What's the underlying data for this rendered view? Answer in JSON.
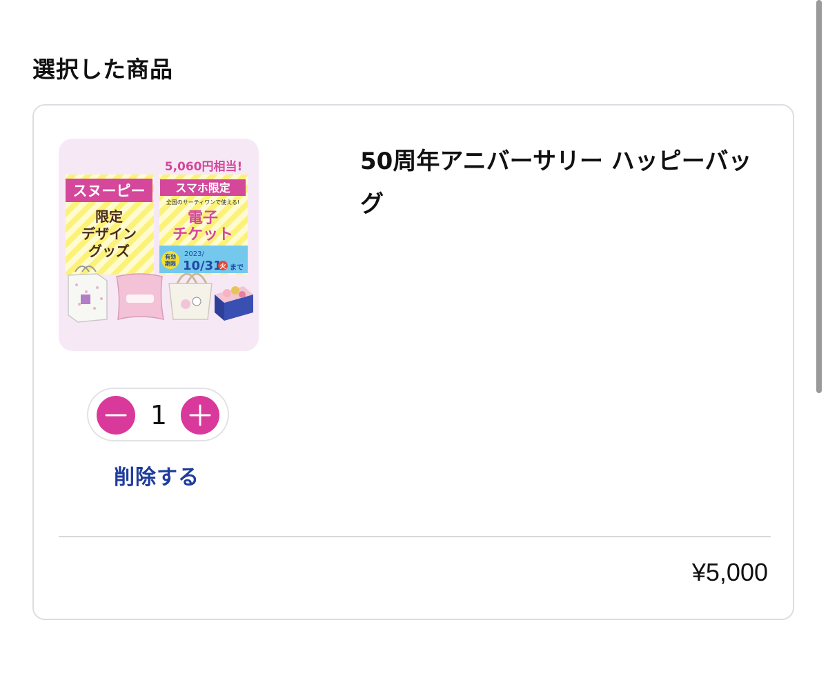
{
  "section": {
    "title": "選択した商品"
  },
  "item": {
    "name": "50周年アニバーサリー ハッピーバッグ",
    "quantity": "1",
    "delete_label": "削除する",
    "price": "¥5,000",
    "image": {
      "ribbon_text": "5,060円相当!",
      "left_title": "スヌーピー",
      "left_body": [
        "限定",
        "デザイン",
        "グッズ"
      ],
      "right_title": "スマホ限定",
      "right_small": "全国のサーティワンで使える!",
      "right_body": [
        "電子",
        "チケット"
      ],
      "period_label": [
        "有効",
        "期限"
      ],
      "period_year": "2023/",
      "period_date": "10/31",
      "period_dow": "火",
      "period_suffix": "まで"
    }
  },
  "colors": {
    "accent": "#d9399a",
    "link": "#1f3c9c",
    "border": "#dcdde3"
  },
  "icons": {
    "decrement": "minus-icon",
    "increment": "plus-icon"
  }
}
